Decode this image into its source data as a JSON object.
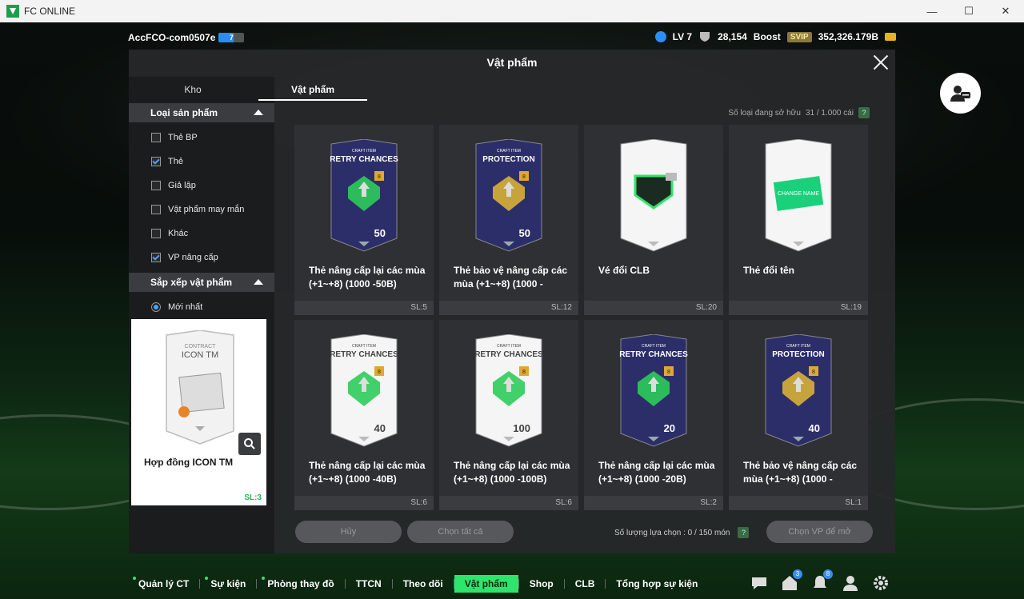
{
  "window": {
    "title": "FC ONLINE",
    "minimize": "—",
    "maximize": "☐",
    "close": "✕"
  },
  "hud": {
    "account": "AccFCO-com0507e",
    "account_badge": "7",
    "level": "LV 7",
    "trophies": "28,154",
    "boost": "Boost",
    "svip": "SVIP",
    "balance": "352,326.179B"
  },
  "modal": {
    "title": "Vật phẩm",
    "tabs": [
      {
        "label": "Kho"
      },
      {
        "label": "Vật phẩm"
      }
    ],
    "owned_label": "Số loại đang sở hữu",
    "owned_value": "31 / 1.000 cái",
    "help": "?",
    "product_type_header": "Loại sản phẩm",
    "filters": [
      {
        "label": "Thẻ BP",
        "checked": false
      },
      {
        "label": "Thẻ",
        "checked": true
      },
      {
        "label": "Giả lập",
        "checked": false
      },
      {
        "label": "Vật phẩm may mắn",
        "checked": false
      },
      {
        "label": "Khác",
        "checked": false
      },
      {
        "label": "VP nâng cấp",
        "checked": true
      }
    ],
    "sort_header": "Sắp xếp vật phẩm",
    "sort_option": "Mới nhất",
    "preview": {
      "card_top": "CONTRACT",
      "card_title": "ICON TM",
      "name": "Hợp đồng ICON TM",
      "qty": "SL:3"
    },
    "items": [
      {
        "name": "Thẻ nâng cấp lại các mùa (+1~+8) (1000 -50B)",
        "qty": "SL:5",
        "card_top": "CRAFT ITEM",
        "card_title": "RETRY CHANCES",
        "value": "50",
        "dark": true
      },
      {
        "name": "Thẻ bảo vệ nâng cấp các mùa (+1~+8) (1000 -",
        "qty": "SL:12",
        "card_top": "CRAFT ITEM",
        "card_title": "PROTECTION",
        "value": "50",
        "dark": true
      },
      {
        "name": "Vé đổi CLB",
        "qty": "SL:20",
        "card_top": "",
        "card_title": "",
        "value": "",
        "dark": false
      },
      {
        "name": "Thẻ đổi tên",
        "qty": "SL:19",
        "card_top": "",
        "card_title": "CHANGE NAME",
        "value": "",
        "dark": false
      },
      {
        "name": "Thẻ nâng cấp lại các mùa (+1~+8) (1000 -40B)",
        "qty": "SL:6",
        "card_top": "CRAFT ITEM",
        "card_title": "RETRY CHANCES",
        "value": "40",
        "dark": false
      },
      {
        "name": "Thẻ nâng cấp lại các mùa (+1~+8) (1000 -100B)",
        "qty": "SL:6",
        "card_top": "CRAFT ITEM",
        "card_title": "RETRY CHANCES",
        "value": "100",
        "dark": false
      },
      {
        "name": "Thẻ nâng cấp lại các mùa (+1~+8) (1000 -20B)",
        "qty": "SL:2",
        "card_top": "CRAFT ITEM",
        "card_title": "RETRY CHANCES",
        "value": "20",
        "dark": true
      },
      {
        "name": "Thẻ bảo vệ nâng cấp các mùa (+1~+8) (1000 -",
        "qty": "SL:1",
        "card_top": "CRAFT ITEM",
        "card_title": "PROTECTION",
        "value": "40",
        "dark": true
      }
    ],
    "buttons": {
      "cancel": "Hủy",
      "select_all": "Chọn tất cả",
      "upgrade": "Chọn VP để mở"
    },
    "selection_label": "Số lượng lựa chọn : 0 / 150 món"
  },
  "nav": [
    {
      "label": "Quản lý CT",
      "dot": true,
      "active": false
    },
    {
      "label": "Sự kiện",
      "dot": true,
      "active": false
    },
    {
      "label": "Phòng thay đồ",
      "dot": true,
      "active": false
    },
    {
      "label": "TTCN",
      "dot": false,
      "active": false
    },
    {
      "label": "Theo dõi",
      "dot": false,
      "active": false
    },
    {
      "label": "Vật phẩm",
      "dot": false,
      "active": true
    },
    {
      "label": "Shop",
      "dot": false,
      "active": false
    },
    {
      "label": "CLB",
      "dot": false,
      "active": false
    },
    {
      "label": "Tổng hợp sự kiện",
      "dot": false,
      "active": false
    }
  ],
  "nav_icons": [
    {
      "icon": "chat-icon",
      "badge": ""
    },
    {
      "icon": "home-icon",
      "badge": "3"
    },
    {
      "icon": "bell-icon",
      "badge": "8"
    },
    {
      "icon": "profile-icon",
      "badge": ""
    },
    {
      "icon": "gear-icon",
      "badge": ""
    }
  ],
  "colors": {
    "accent": "#2ee56b",
    "check": "#4ea3ff"
  }
}
